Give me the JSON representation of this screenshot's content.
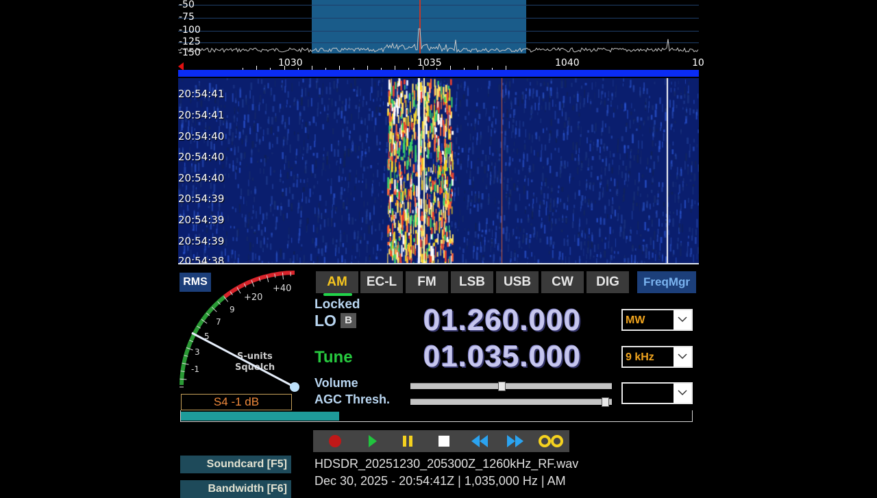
{
  "spectrum": {
    "db_labels": [
      "-50",
      "-75",
      "-100",
      "-125",
      "-150"
    ]
  },
  "ruler": {
    "freq_labels": [
      "1030",
      "1035",
      "1040",
      "10"
    ]
  },
  "waterfall": {
    "timestamps": [
      "20:54:41",
      "20:54:41",
      "20:54:40",
      "20:54:40",
      "20:54:40",
      "20:54:39",
      "20:54:39",
      "20:54:39",
      "20:54:38"
    ]
  },
  "meter": {
    "rms_label": "RMS",
    "scale_labels": [
      "-1",
      "3",
      "5",
      "7",
      "9",
      "+20",
      "+40"
    ],
    "caption_line1": "S-units",
    "caption_line2": "Squelch",
    "readout": "S4 -1 dB"
  },
  "modes": {
    "buttons": [
      "AM",
      "EC-L",
      "FM",
      "LSB",
      "USB",
      "CW",
      "DIG"
    ],
    "active": "AM",
    "freqmgr_label": "FreqMgr"
  },
  "lo": {
    "locked_label": "Locked",
    "lo_label": "LO",
    "b_label": "B",
    "frequency": "01.260.000",
    "band": "MW"
  },
  "tune": {
    "label": "Tune",
    "frequency": "01.035.000",
    "step": "9 kHz"
  },
  "controls": {
    "volume_label": "Volume",
    "agc_label": "AGC Thresh.",
    "volume_level": 0.45,
    "agc_level": 0.98,
    "third_combo_value": ""
  },
  "playback": {
    "progress": 0.31
  },
  "transport": {
    "buttons": [
      "record-icon",
      "play-icon",
      "pause-icon",
      "stop-icon",
      "rewind-icon",
      "fast-forward-icon",
      "loop-icon"
    ]
  },
  "side_buttons": {
    "soundcard": "Soundcard [F5]",
    "bandwidth": "Bandwidth [F6]"
  },
  "file": {
    "name": "HDSDR_20251230_205300Z_1260kHz_RF.wav",
    "status": "Dec 30, 2025 - 20:54:41Z | 1,035,000 Hz | AM"
  },
  "colors": {
    "accent_active": "#f5c51f",
    "tune_green": "#27c93f",
    "waterfall_bg": "#0a1e6e"
  }
}
